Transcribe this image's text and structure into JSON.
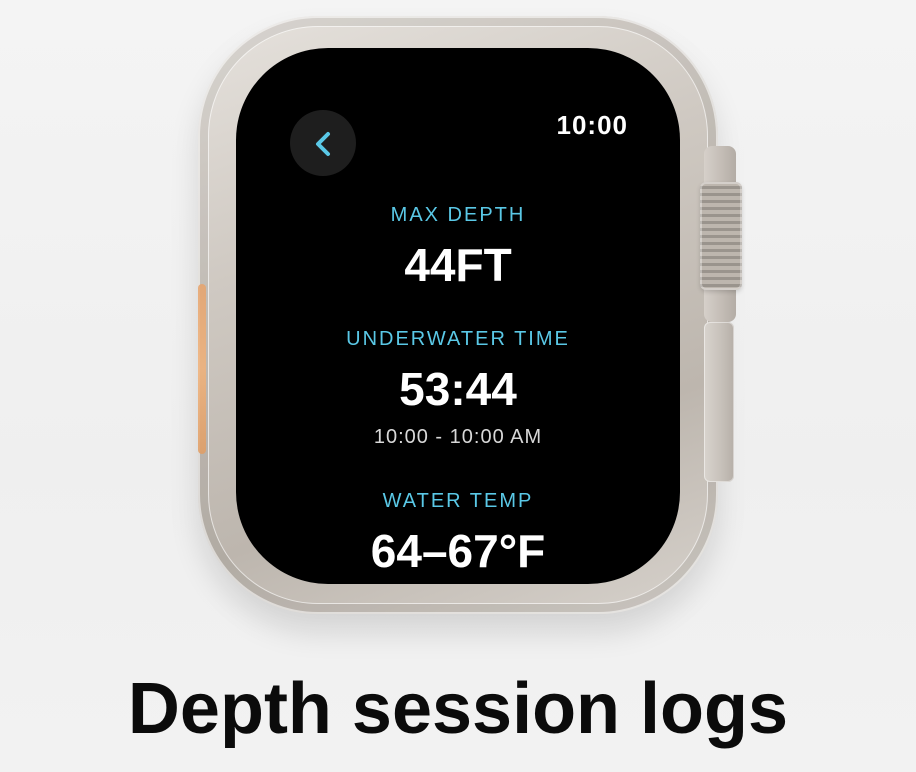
{
  "watch": {
    "clock": "10:00",
    "accent_color": "#5ac8e6",
    "back_icon": "chevron-left-icon",
    "metrics": [
      {
        "label": "Max Depth",
        "value": "44FT"
      },
      {
        "label": "Underwater Time",
        "value": "53:44",
        "sub": "10:00 - 10:00 AM"
      },
      {
        "label": "Water Temp",
        "value": "64–67°F"
      }
    ]
  },
  "caption": "Depth session logs"
}
